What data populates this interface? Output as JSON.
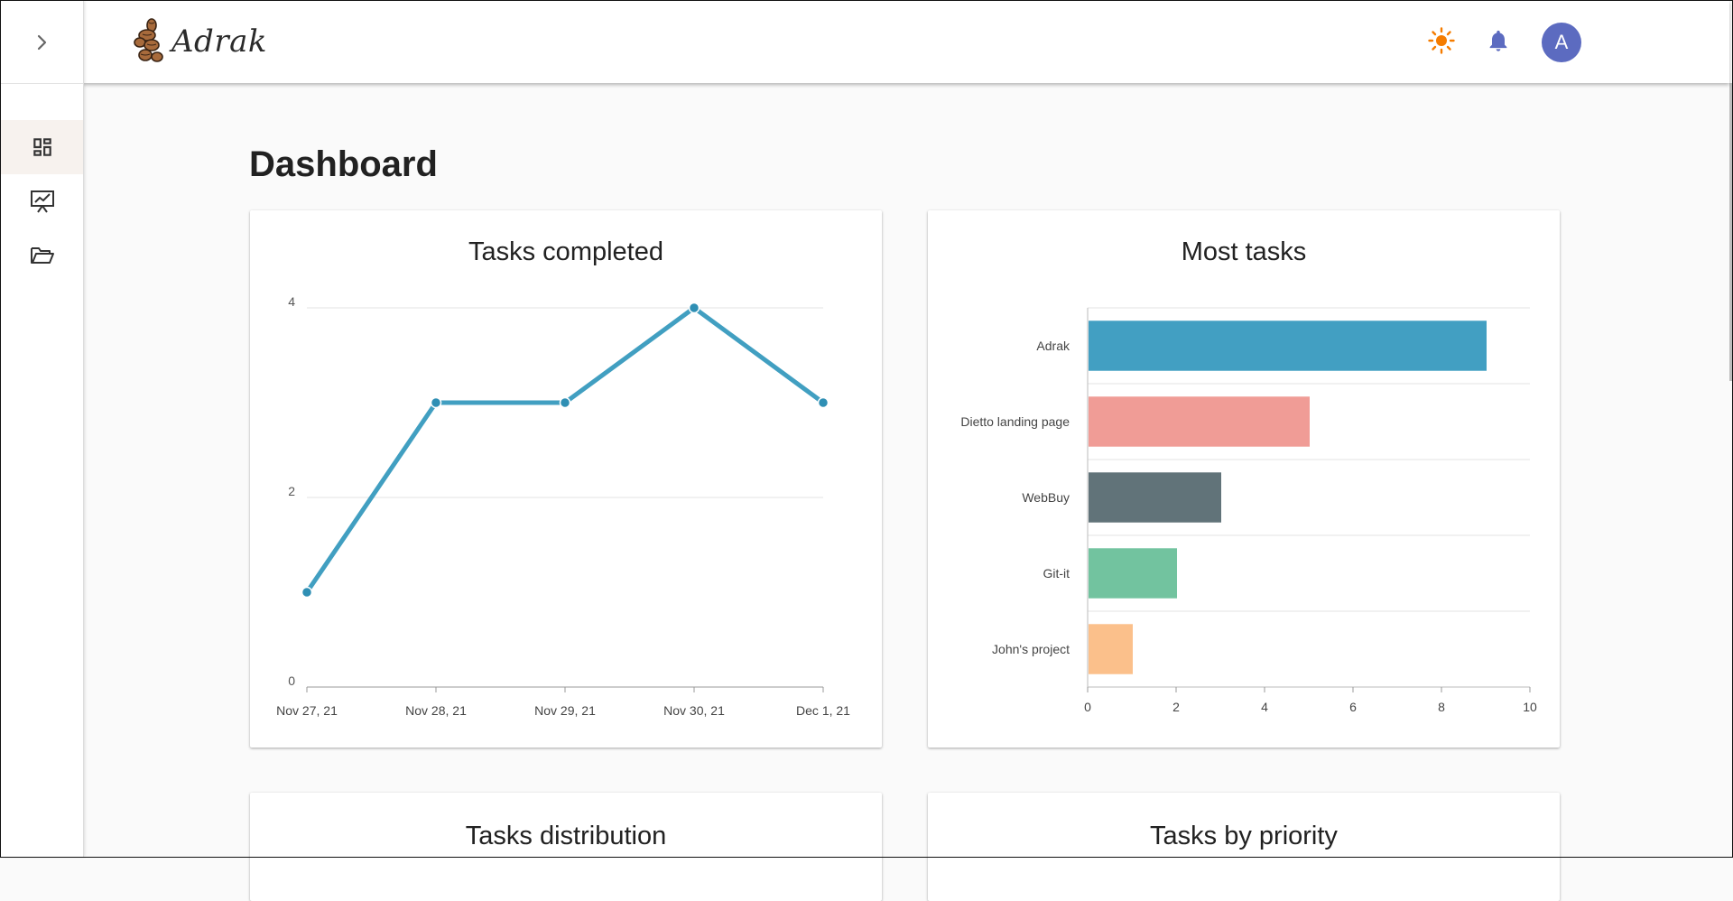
{
  "app": {
    "name": "Adrak"
  },
  "header": {
    "theme_icon": "sun-icon",
    "notifications_icon": "bell-icon",
    "avatar_initial": "A"
  },
  "sidebar": {
    "toggle_icon": "chevron-right-icon",
    "items": [
      {
        "icon": "dashboard-icon",
        "active": true
      },
      {
        "icon": "presentation-chart-icon",
        "active": false
      },
      {
        "icon": "folder-open-icon",
        "active": false
      }
    ]
  },
  "page": {
    "title": "Dashboard"
  },
  "cards": {
    "tasks_completed": {
      "title": "Tasks completed"
    },
    "most_tasks": {
      "title": "Most tasks"
    },
    "tasks_distribution": {
      "title": "Tasks distribution"
    },
    "tasks_by_priority": {
      "title": "Tasks by priority"
    }
  },
  "chart_data": [
    {
      "type": "line",
      "title": "Tasks completed",
      "x": [
        "Nov 27, 21",
        "Nov 28, 21",
        "Nov 29, 21",
        "Nov 30, 21",
        "Dec 1, 21"
      ],
      "values": [
        1,
        3,
        3,
        4,
        3
      ],
      "yticks": [
        "0",
        "2",
        "4"
      ],
      "ylim": [
        0,
        4
      ],
      "grid": true,
      "color": "#419fc1"
    },
    {
      "type": "bar",
      "orientation": "horizontal",
      "title": "Most tasks",
      "categories": [
        "Adrak",
        "Dietto landing page",
        "WebBuy",
        "Git-it",
        "John's project"
      ],
      "values": [
        9,
        5,
        3,
        2,
        1
      ],
      "colors": [
        "#429fc2",
        "#f09c96",
        "#617379",
        "#72c39f",
        "#fbc08b"
      ],
      "xticks": [
        "0",
        "2",
        "4",
        "6",
        "8",
        "10"
      ],
      "xlim": [
        0,
        10
      ],
      "grid": true
    }
  ]
}
